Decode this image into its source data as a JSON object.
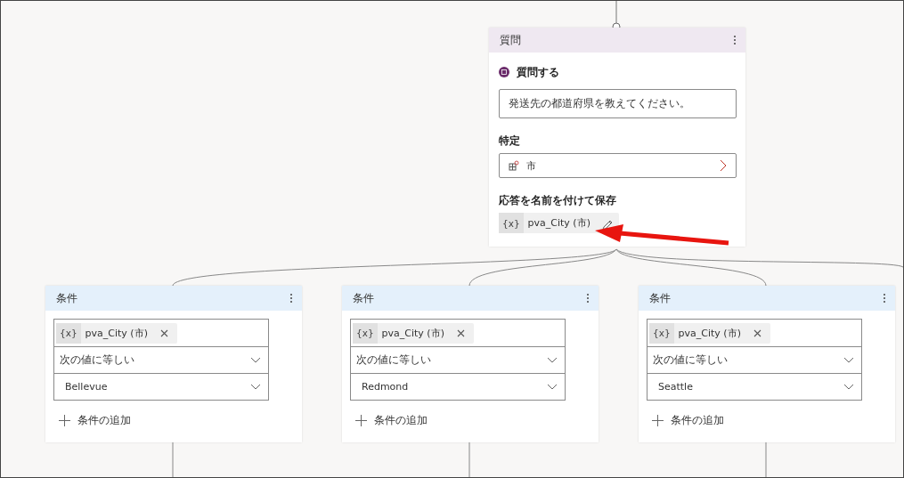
{
  "question_node": {
    "header": "質問",
    "title": "質問する",
    "prompt": "発送先の都道府県を教えてください。",
    "identify_label": "特定",
    "entity": "市",
    "save_label": "応答を名前を付けて保存",
    "variable_prefix": "{x}",
    "variable": "pva_City (市)"
  },
  "condition_nodes": [
    {
      "header": "条件",
      "variable_prefix": "{x}",
      "variable": "pva_City (市)",
      "operator": "次の値に等しい",
      "value": "Bellevue",
      "add_label": "条件の追加"
    },
    {
      "header": "条件",
      "variable_prefix": "{x}",
      "variable": "pva_City (市)",
      "operator": "次の値に等しい",
      "value": "Redmond",
      "add_label": "条件の追加"
    },
    {
      "header": "条件",
      "variable_prefix": "{x}",
      "variable": "pva_City (市)",
      "operator": "次の値に等しい",
      "value": "Seattle",
      "add_label": "条件の追加"
    }
  ]
}
